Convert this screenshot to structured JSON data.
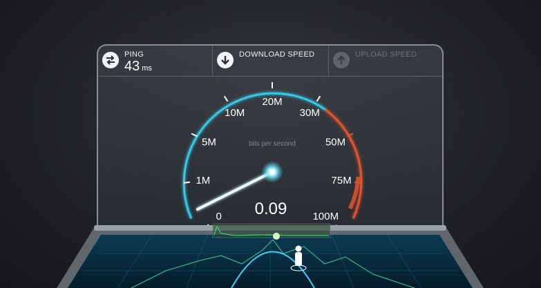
{
  "ping": {
    "label": "PING",
    "value": "43",
    "unit": "ms",
    "icon": "exchange-arrows-icon"
  },
  "download": {
    "label": "DOWNLOAD SPEED",
    "icon": "down-arrow-icon"
  },
  "upload": {
    "label": "UPLOAD SPEED",
    "icon": "up-arrow-icon"
  },
  "gauge": {
    "ticks": [
      "0",
      "1M",
      "5M",
      "10M",
      "20M",
      "30M",
      "50M",
      "75M",
      "100M"
    ],
    "subtitle": "bits per second",
    "reading": "0.09"
  },
  "colors": {
    "accent": "#37c8e6",
    "warning": "#e4522e",
    "panel_border": "#8a9096"
  }
}
